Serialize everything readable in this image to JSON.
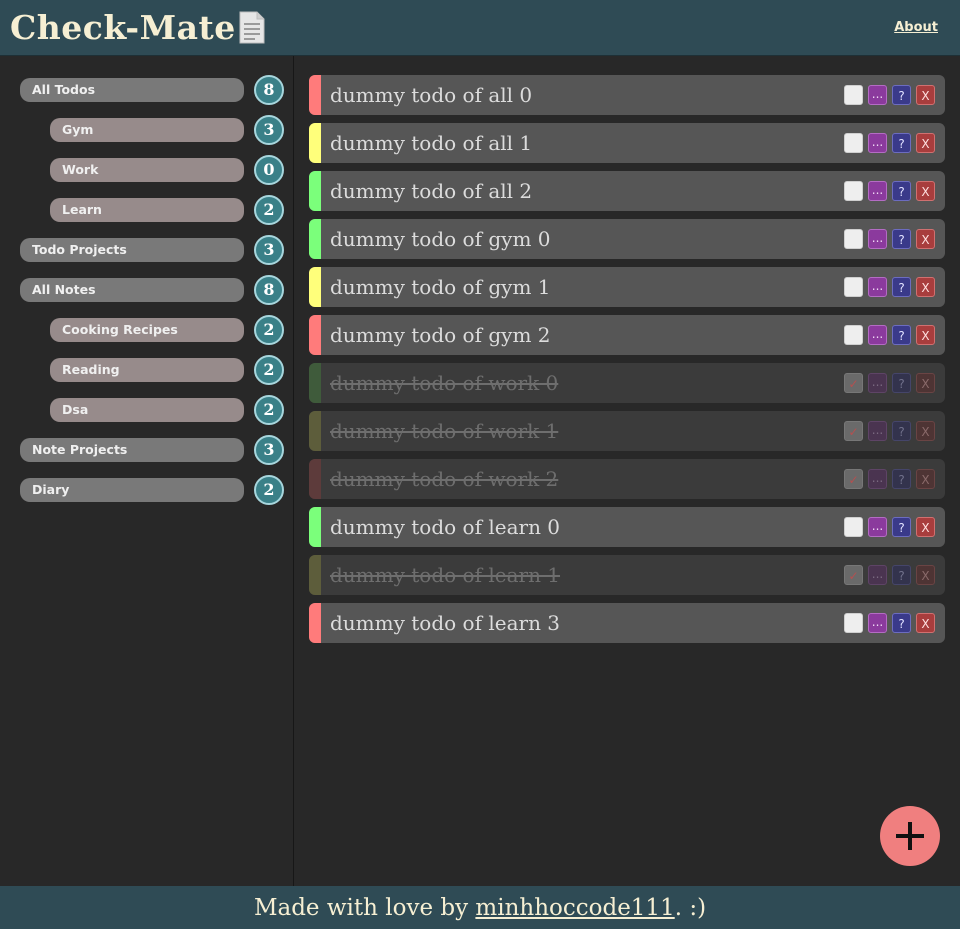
{
  "header": {
    "title": "Check-Mate",
    "about_label": "About"
  },
  "sidebar": {
    "items": [
      {
        "label": "All Todos",
        "count": "8",
        "level": "top"
      },
      {
        "label": "Gym",
        "count": "3",
        "level": "sub"
      },
      {
        "label": "Work",
        "count": "0",
        "level": "sub"
      },
      {
        "label": "Learn",
        "count": "2",
        "level": "sub"
      },
      {
        "label": "Todo Projects",
        "count": "3",
        "level": "top"
      },
      {
        "label": "All Notes",
        "count": "8",
        "level": "top"
      },
      {
        "label": "Cooking Recipes",
        "count": "2",
        "level": "sub"
      },
      {
        "label": "Reading",
        "count": "2",
        "level": "sub"
      },
      {
        "label": "Dsa",
        "count": "2",
        "level": "sub"
      },
      {
        "label": "Note Projects",
        "count": "3",
        "level": "top"
      },
      {
        "label": "Diary",
        "count": "2",
        "level": "top"
      }
    ]
  },
  "todos": [
    {
      "text": "dummy todo of all 0",
      "priority_color": "#ff7b7b",
      "done": false
    },
    {
      "text": "dummy todo of all 1",
      "priority_color": "#ffff7b",
      "done": false
    },
    {
      "text": "dummy todo of all 2",
      "priority_color": "#7bff7b",
      "done": false
    },
    {
      "text": "dummy todo of gym 0",
      "priority_color": "#7bff7b",
      "done": false
    },
    {
      "text": "dummy todo of gym 1",
      "priority_color": "#ffff7b",
      "done": false
    },
    {
      "text": "dummy todo of gym 2",
      "priority_color": "#ff7b7b",
      "done": false
    },
    {
      "text": "dummy todo of work 0",
      "priority_color": "#3f5b3b",
      "done": true
    },
    {
      "text": "dummy todo of work 1",
      "priority_color": "#5d5d3b",
      "done": true
    },
    {
      "text": "dummy todo of work 2",
      "priority_color": "#5d3b3b",
      "done": true
    },
    {
      "text": "dummy todo of learn 0",
      "priority_color": "#7bff7b",
      "done": false
    },
    {
      "text": "dummy todo of learn 1",
      "priority_color": "#5d5d3b",
      "done": true
    },
    {
      "text": "dummy todo of learn 3",
      "priority_color": "#ff7b7b",
      "done": false
    }
  ],
  "controls": {
    "check_done": "✓",
    "more": "...",
    "help": "?",
    "delete": "X"
  },
  "footer": {
    "prefix": "Made with love by ",
    "author": "minhhoccode111",
    "suffix": ". :)"
  },
  "colors": {
    "header_bg": "#2f4b55",
    "badge_bg": "#3a8088",
    "fab_bg": "#f07f7f"
  }
}
